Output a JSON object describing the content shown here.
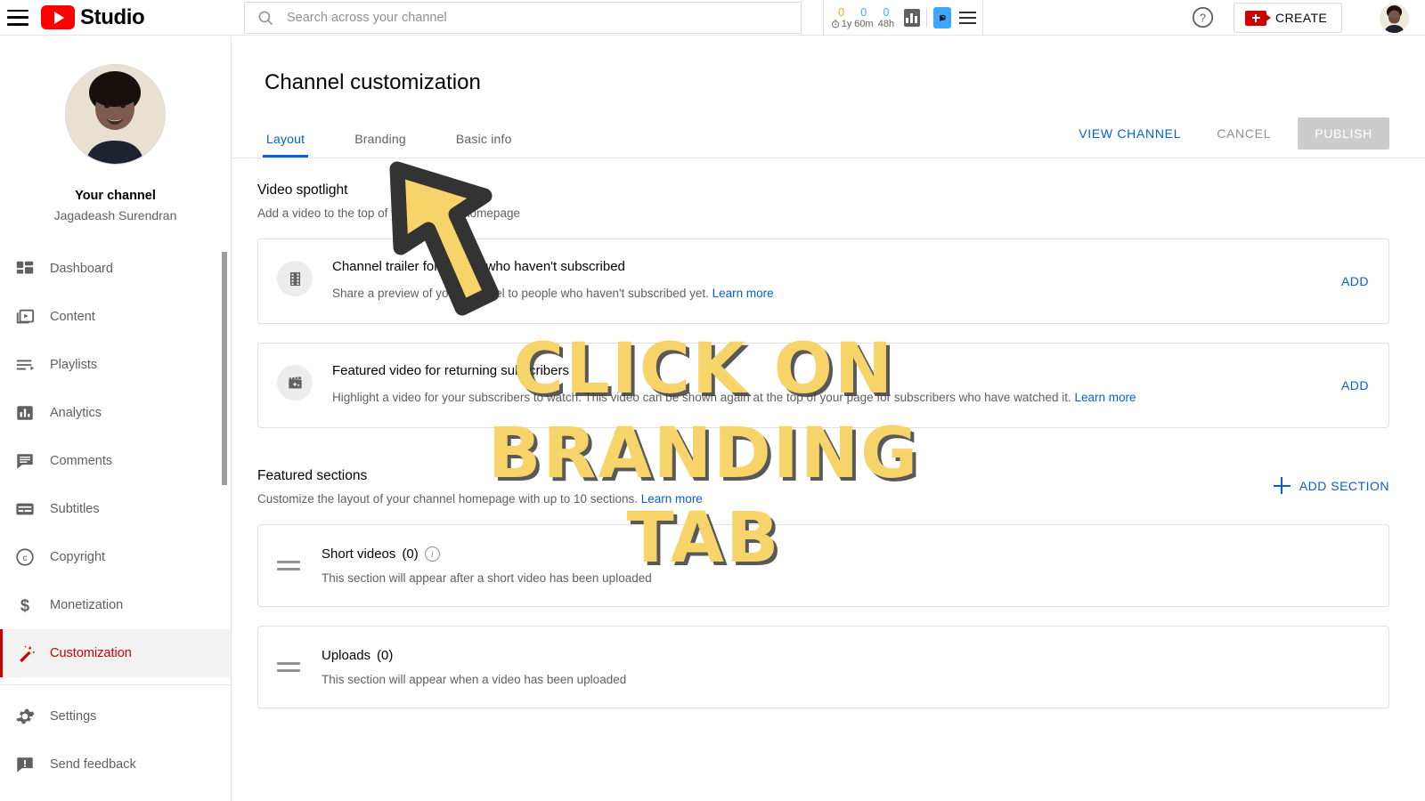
{
  "topbar": {
    "menu_icon": "hamburger-icon",
    "brand": "Studio",
    "search": {
      "placeholder": "Search across your channel",
      "value": "",
      "icon": "search-icon"
    },
    "analytics_widget": {
      "metrics": [
        {
          "value": "0",
          "label": "1y",
          "color": "#f5a623",
          "has_clock": true
        },
        {
          "value": "0",
          "label": "60m",
          "color": "#3ea6ff",
          "has_clock": false
        },
        {
          "value": "0",
          "label": "48h",
          "color": "#3ea6ff",
          "has_clock": false
        }
      ],
      "chart_icon": "bar-chart-icon",
      "highlight_icon": "analytics-play-icon",
      "list_icon": "list-icon"
    },
    "help_icon": "help-circle-icon",
    "create_label": "CREATE",
    "create_icon": "video-plus-icon",
    "account_avatar": "account-avatar"
  },
  "sidebar": {
    "channel": {
      "avatar": "channel-avatar",
      "title": "Your channel",
      "name": "Jagadeash Surendran"
    },
    "items": [
      {
        "label": "Dashboard",
        "icon": "dashboard-icon",
        "active": false
      },
      {
        "label": "Content",
        "icon": "video-stack-icon",
        "active": false
      },
      {
        "label": "Playlists",
        "icon": "playlist-icon",
        "active": false
      },
      {
        "label": "Analytics",
        "icon": "analytics-icon",
        "active": false
      },
      {
        "label": "Comments",
        "icon": "comment-icon",
        "active": false
      },
      {
        "label": "Subtitles",
        "icon": "subtitles-icon",
        "active": false
      },
      {
        "label": "Copyright",
        "icon": "copyright-icon",
        "active": false
      },
      {
        "label": "Monetization",
        "icon": "dollar-icon",
        "active": false
      },
      {
        "label": "Customization",
        "icon": "magic-wand-icon",
        "active": true
      }
    ],
    "footer_items": [
      {
        "label": "Settings",
        "icon": "gear-icon"
      },
      {
        "label": "Send feedback",
        "icon": "feedback-icon"
      }
    ]
  },
  "main": {
    "page_title": "Channel customization",
    "tabs": [
      {
        "label": "Layout",
        "active": true
      },
      {
        "label": "Branding",
        "active": false
      },
      {
        "label": "Basic info",
        "active": false
      }
    ],
    "actions": {
      "view_channel": "VIEW CHANNEL",
      "cancel": "CANCEL",
      "publish": "PUBLISH"
    },
    "video_spotlight": {
      "title": "Video spotlight",
      "description": "Add a video to the top of your channel homepage",
      "cards": [
        {
          "icon": "film-strip-icon",
          "title": "Channel trailer for people who haven't subscribed",
          "description": "Share a preview of your channel to people who haven't subscribed yet.",
          "learn_more": "Learn more",
          "action": "ADD"
        },
        {
          "icon": "clapboard-sparkle-icon",
          "title": "Featured video for returning subscribers",
          "description": "Highlight a video for your subscribers to watch. This video can be shown again at the top of your page for subscribers who have watched it.",
          "learn_more": "Learn more",
          "action": "ADD"
        }
      ]
    },
    "featured_sections": {
      "title": "Featured sections",
      "description": "Customize the layout of your channel homepage with up to 10 sections.",
      "learn_more": "Learn more",
      "add_section": "ADD SECTION",
      "rows": [
        {
          "name": "Short videos",
          "count": "(0)",
          "has_info": true,
          "description": "This section will appear after a short video has been uploaded"
        },
        {
          "name": "Uploads",
          "count": "(0)",
          "has_info": false,
          "description": "This section will appear when a video has been uploaded"
        }
      ]
    }
  },
  "annotation": {
    "arrow_icon": "instruction-arrow-icon",
    "line1": "CLICK ON",
    "line2": "BRANDING TAB",
    "text_color": "#f7d46a"
  }
}
